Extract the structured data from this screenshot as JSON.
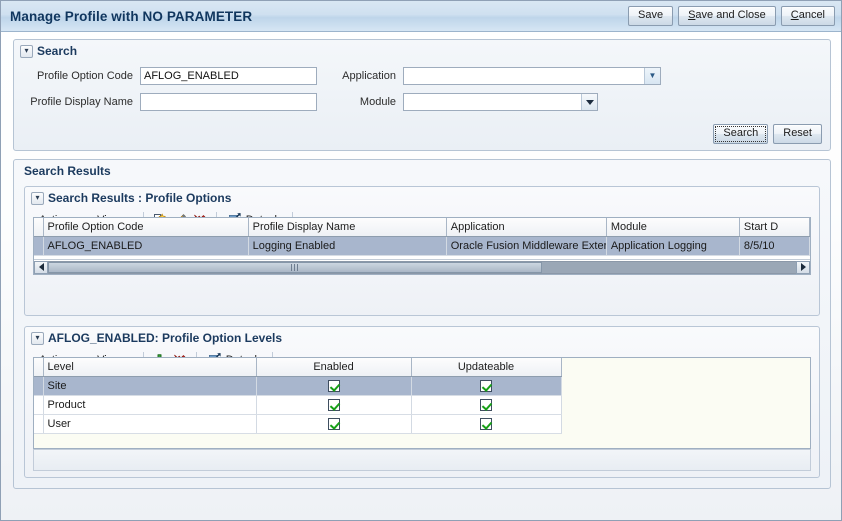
{
  "window": {
    "title": "Manage Profile with NO PARAMETER",
    "buttons": [
      {
        "label": "Save",
        "mnemonic": "",
        "focused": false
      },
      {
        "label": "Save and Close",
        "mnemonic": "S",
        "focused": false
      },
      {
        "label": "Cancel",
        "mnemonic": "C",
        "focused": false
      }
    ]
  },
  "search": {
    "section_label": "Search",
    "disclosure_icon": "chevron-down-icon",
    "fields": {
      "profile_option_code": {
        "label": "Profile Option Code",
        "value": "AFLOG_ENABLED",
        "placeholder": ""
      },
      "profile_display_name": {
        "label": "Profile Display Name",
        "value": "",
        "placeholder": ""
      },
      "application": {
        "label": "Application",
        "value": "",
        "placeholder": "",
        "control": "lov-dropdown"
      },
      "module": {
        "label": "Module",
        "value": "",
        "placeholder": "",
        "control": "select-dropdown"
      }
    },
    "actions": {
      "search_label": "Search",
      "reset_label": "Reset"
    }
  },
  "results_region": {
    "title": "Search Results"
  },
  "profile_options": {
    "section_label": "Search Results : Profile Options",
    "disclosure_icon": "chevron-down-icon",
    "toolbar": {
      "actions_label": "Actions",
      "view_label": "View",
      "icons": [
        "new-document-icon",
        "edit-pencil-icon",
        "delete-x-icon"
      ],
      "detach_label": "Detach",
      "detach_icon": "detach-icon"
    },
    "columns": [
      "Profile Option Code",
      "Profile Display Name",
      "Application",
      "Module",
      "Start D"
    ],
    "rows": [
      {
        "selected": true,
        "cells": [
          "AFLOG_ENABLED",
          "Logging Enabled",
          "Oracle Fusion Middleware Exter",
          "Application Logging",
          "8/5/10"
        ]
      }
    ],
    "scrollbar": {
      "orientation": "horizontal",
      "thumb_fraction": 0.66,
      "left_icon": "arrow-left-icon",
      "right_icon": "arrow-right-icon"
    }
  },
  "profile_option_levels": {
    "section_label": "AFLOG_ENABLED: Profile Option Levels",
    "disclosure_icon": "chevron-down-icon",
    "toolbar": {
      "actions_label": "Actions",
      "view_label": "View",
      "icons": [
        "add-plus-icon",
        "delete-x-icon"
      ],
      "detach_label": "Detach",
      "detach_icon": "detach-icon"
    },
    "columns": [
      "Level",
      "Enabled",
      "Updateable"
    ],
    "rows": [
      {
        "selected": true,
        "level": "Site",
        "enabled": true,
        "updateable": true
      },
      {
        "selected": false,
        "level": "Product",
        "enabled": true,
        "updateable": true
      },
      {
        "selected": false,
        "level": "User",
        "enabled": true,
        "updateable": true
      }
    ]
  },
  "colors": {
    "title_text": "#10365e",
    "section_heading": "#1b3a5e",
    "row_selected": "#a8b6cd",
    "checkmark_green": "#17a017",
    "delete_red": "#cc2b24",
    "add_green": "#2f9e2f",
    "titlebar_gradient_top": "#d9e7f3",
    "panel_border": "#b6c4d4",
    "ivory_fill": "#fbfcf3"
  }
}
